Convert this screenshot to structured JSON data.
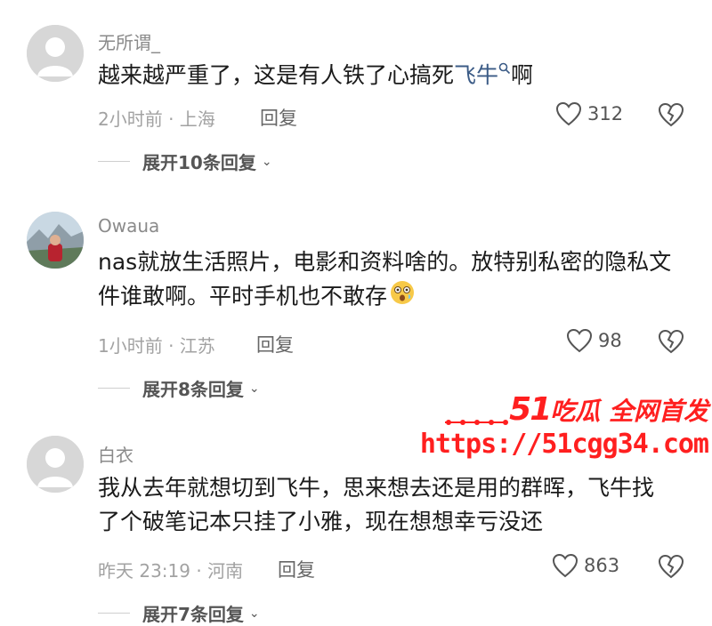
{
  "comments": [
    {
      "username": "无所谓_",
      "text_before": "越来越严重了，这是有人铁了心搞死",
      "link": "飞牛",
      "text_after": "啊",
      "meta": "2小时前 · 上海",
      "reply": "回复",
      "likes": "312",
      "expand": "展开10条回复"
    },
    {
      "username": "Owaua",
      "text": "nas就放生活照片，电影和资料啥的。放特别私密的隐私文件谁敢啊。平时手机也不敢存",
      "meta": "1小时前 · 江苏",
      "reply": "回复",
      "likes": "98",
      "expand": "展开8条回复"
    },
    {
      "username": "白衣",
      "text": "我从去年就想切到飞牛，思来想去还是用的群晖，飞牛找了个破笔记本只挂了小雅，现在想想幸亏没还",
      "meta": "昨天 23:19 · 河南",
      "reply": "回复",
      "likes": "863",
      "expand": "展开7条回复"
    }
  ],
  "watermark": {
    "brand_number": "51",
    "brand_text": "吃瓜 全网首发",
    "url": "https://51cgg34.com"
  },
  "colors": {
    "link": "#3b5b86",
    "watermark": "#ff1f1f",
    "meta": "#a2a2a2"
  }
}
